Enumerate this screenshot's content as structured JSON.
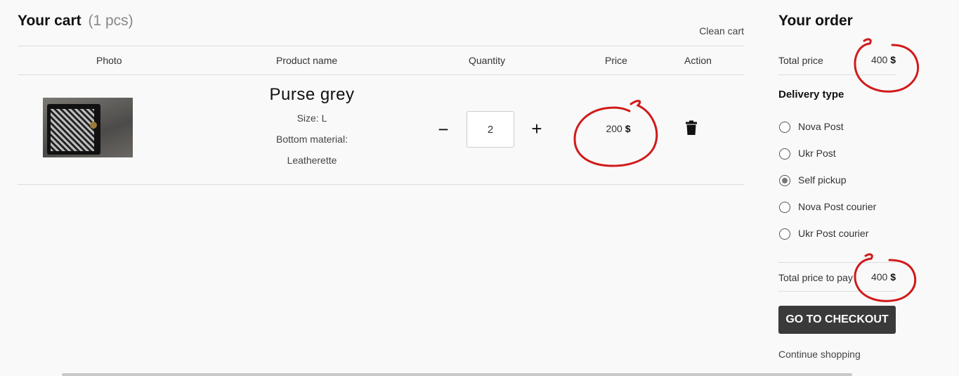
{
  "cart": {
    "title": "Your cart",
    "count": "(1 pcs)",
    "clean_label": "Clean cart",
    "columns": [
      "Photo",
      "Product name",
      "Quantity",
      "Price",
      "Action"
    ],
    "item": {
      "name": "Purse grey",
      "size": "Size: L",
      "material_label": "Bottom material:",
      "material_value": "Leatherette",
      "quantity": "2",
      "minus": "−",
      "plus": "+",
      "price_value": "200",
      "currency": "$"
    }
  },
  "order": {
    "title": "Your order",
    "total_label": "Total price",
    "total_value": "400",
    "currency": "$",
    "delivery_title": "Delivery type",
    "delivery_options": [
      {
        "label": "Nova Post",
        "selected": false
      },
      {
        "label": "Ukr Post",
        "selected": false
      },
      {
        "label": "Self pickup",
        "selected": true
      },
      {
        "label": "Nova Post courier",
        "selected": false
      },
      {
        "label": "Ukr Post courier",
        "selected": false
      }
    ],
    "pay_label": "Total price to pay",
    "pay_value": "400",
    "checkout_label": "GO TO CHECKOUT",
    "continue_label": "Continue shopping"
  },
  "colors": {
    "annotation": "#d11a1a",
    "button_bg": "#3a3a3a",
    "page_bg": "#f9f9f9"
  }
}
